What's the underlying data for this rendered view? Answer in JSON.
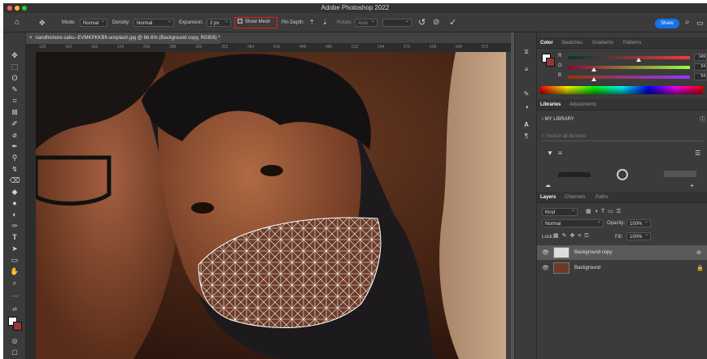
{
  "app": {
    "title": "Adobe Photoshop 2022"
  },
  "options_bar": {
    "mode_label": "Mode:",
    "mode_value": "Normal",
    "density_label": "Density:",
    "density_value": "Normal",
    "expansion_label": "Expansion:",
    "expansion_value": "2 px",
    "show_mesh_label": "Show Mesh",
    "pin_depth_label": "Pin Depth:",
    "rotate_label": "Rotate:",
    "rotate_value": "Auto",
    "share_label": "Share"
  },
  "document": {
    "tab_label": "nandhishore-sahu--EVMKPKKBfl-unsplash.jpg @ 66.6% (Background copy, RGB/8) *",
    "ruler_ticks": [
      "128",
      "160",
      "192",
      "224",
      "256",
      "288",
      "320",
      "352",
      "384",
      "416",
      "448",
      "480",
      "512",
      "544",
      "576",
      "608",
      "640",
      "672"
    ]
  },
  "color_panel": {
    "tabs": [
      "Color",
      "Swatches",
      "Gradients",
      "Patterns"
    ],
    "channels": [
      {
        "label": "R",
        "value": "149",
        "fraction": 0.58
      },
      {
        "label": "G",
        "value": "54",
        "fraction": 0.21
      },
      {
        "label": "B",
        "value": "54",
        "fraction": 0.21
      }
    ]
  },
  "libraries_panel": {
    "tabs": [
      "Libraries",
      "Adjustments"
    ],
    "library_name": "MY LIBRARY",
    "search_placeholder": "Search all libraries"
  },
  "layers_panel": {
    "tabs": [
      "Layers",
      "Channels",
      "Paths"
    ],
    "filter_value": "Kind",
    "blend_mode": "Normal",
    "opacity_label": "Opacity:",
    "opacity_value": "100%",
    "lock_label": "Lock:",
    "fill_label": "Fill:",
    "fill_value": "100%",
    "layers": [
      {
        "name": "Background copy"
      },
      {
        "name": "Background"
      }
    ]
  },
  "colors": {
    "accent": "#1473e6",
    "highlight_box": "#e02020",
    "foreground": "#953636"
  }
}
